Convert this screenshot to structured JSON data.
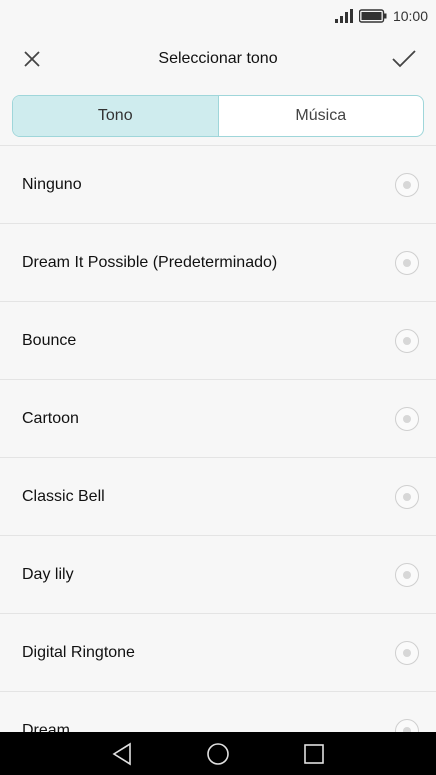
{
  "status_bar": {
    "time": "10:00"
  },
  "header": {
    "title": "Seleccionar tono"
  },
  "tabs": [
    {
      "label": "Tono",
      "active": true
    },
    {
      "label": "Música",
      "active": false
    }
  ],
  "ringtones": [
    {
      "label": "Ninguno"
    },
    {
      "label": "Dream It Possible (Predeterminado)"
    },
    {
      "label": "Bounce"
    },
    {
      "label": "Cartoon"
    },
    {
      "label": "Classic Bell"
    },
    {
      "label": "Day lily"
    },
    {
      "label": "Digital Ringtone"
    },
    {
      "label": "Dream"
    }
  ],
  "colors": {
    "accent": "#cfecee",
    "accent_border": "#9fd6da"
  }
}
